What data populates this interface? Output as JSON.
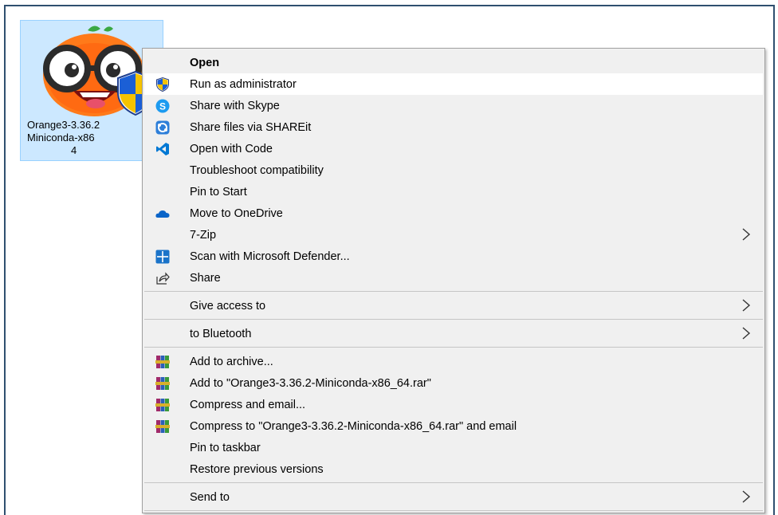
{
  "desktop": {
    "file_label_lines": [
      "Orange3-3.36.2",
      "Miniconda-x86",
      "4"
    ]
  },
  "menu": {
    "items": [
      {
        "label": "Open",
        "icon": ""
      },
      {
        "label": "Run as administrator",
        "icon": "uac-shield-icon"
      },
      {
        "label": "Share with Skype",
        "icon": "skype-icon"
      },
      {
        "label": "Share files via SHAREit",
        "icon": "shareit-icon"
      },
      {
        "label": "Open with Code",
        "icon": "vscode-icon"
      },
      {
        "label": "Troubleshoot compatibility",
        "icon": ""
      },
      {
        "label": "Pin to Start",
        "icon": ""
      },
      {
        "label": "Move to OneDrive",
        "icon": "onedrive-icon"
      },
      {
        "label": "7-Zip",
        "icon": ""
      },
      {
        "label": "Scan with Microsoft Defender...",
        "icon": "defender-icon"
      },
      {
        "label": "Share",
        "icon": "share-icon"
      },
      {
        "label": "Give access to",
        "icon": ""
      },
      {
        "label": "to Bluetooth",
        "icon": ""
      },
      {
        "label": "Add to archive...",
        "icon": "winrar-icon"
      },
      {
        "label": "Add to \"Orange3-3.36.2-Miniconda-x86_64.rar\"",
        "icon": "winrar-icon"
      },
      {
        "label": "Compress and email...",
        "icon": "winrar-icon"
      },
      {
        "label": "Compress to \"Orange3-3.36.2-Miniconda-x86_64.rar\" and email",
        "icon": "winrar-icon"
      },
      {
        "label": "Pin to taskbar",
        "icon": ""
      },
      {
        "label": "Restore previous versions",
        "icon": ""
      },
      {
        "label": "Send to",
        "icon": ""
      }
    ]
  },
  "colors": {
    "menu_bg": "#f0f0f0",
    "hover_bg": "#ffffff",
    "selection_bg": "#cce8ff",
    "vscode_blue": "#0078d4",
    "onedrive_blue": "#0a64c8"
  }
}
